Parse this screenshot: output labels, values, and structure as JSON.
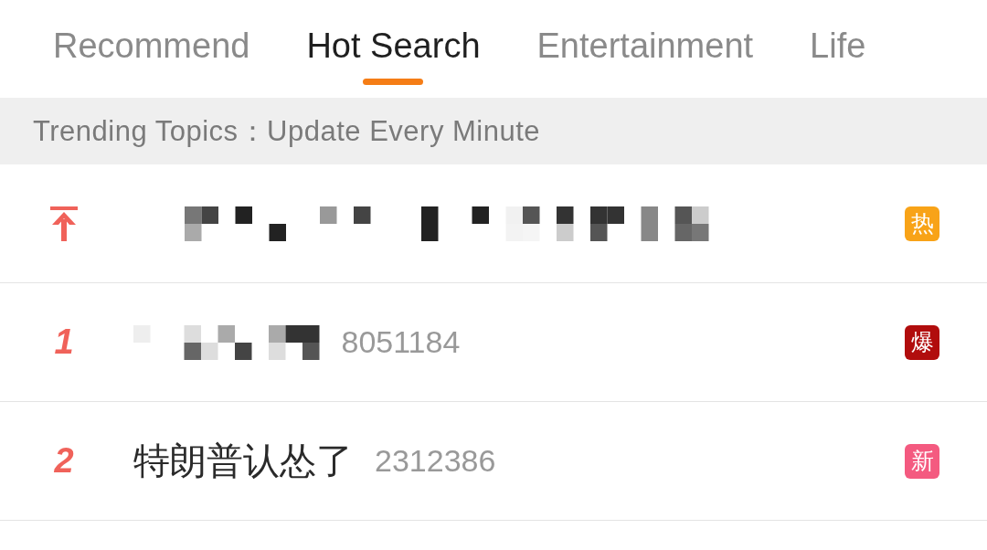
{
  "tabs": [
    {
      "label": "Recommend",
      "selected": false
    },
    {
      "label": "Hot Search",
      "selected": true
    },
    {
      "label": "Entertainment",
      "selected": false
    },
    {
      "label": "Life",
      "selected": false
    }
  ],
  "banner": {
    "text": "Trending Topics：Update Every Minute"
  },
  "rows": [
    {
      "kind": "pinned",
      "redacted": true,
      "badge": {
        "text": "热",
        "color": "#f8a318"
      }
    },
    {
      "kind": "ranked",
      "rank": "1",
      "redacted": true,
      "count": "8051184",
      "badge": {
        "text": "爆",
        "color": "#b10d0d"
      }
    },
    {
      "kind": "ranked",
      "rank": "2",
      "title": "特朗普认怂了",
      "count": "2312386",
      "badge": {
        "text": "新",
        "color": "#f45a80"
      }
    }
  ]
}
